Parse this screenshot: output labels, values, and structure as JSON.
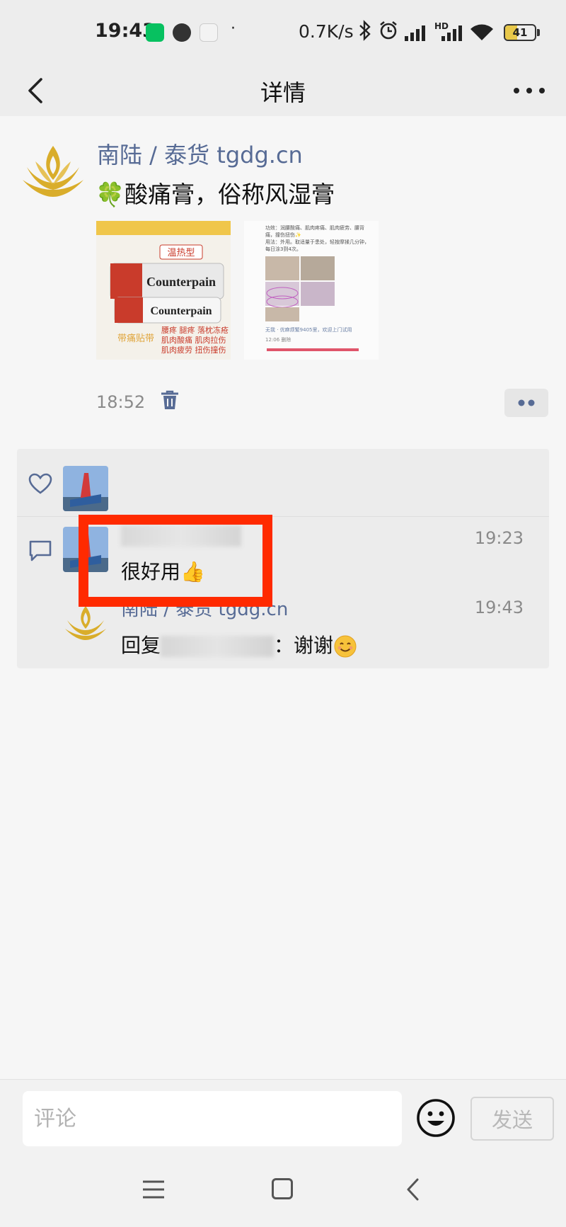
{
  "status_bar": {
    "time": "19:43",
    "dot": "·",
    "network_speed": "0.7K/s",
    "network_type": "HD",
    "battery_level": "41",
    "battery_fraction": 0.41,
    "icons": [
      "wechat-icon",
      "clock-app-icon",
      "weather-icon",
      "bluetooth-icon",
      "alarm-icon",
      "signal-icon",
      "wifi-icon",
      "battery-icon"
    ]
  },
  "nav": {
    "title": "详情",
    "back_icon": "chevron-left-icon",
    "more_icon": "more-dots-icon"
  },
  "post": {
    "author": "南陆 / 泰货 tgdg.cn",
    "text": "🍀酸痛膏，俗称风湿膏",
    "image1": {
      "badge": "温热型",
      "brand": "Counterpain",
      "lines": [
        "腰疼 腿疼 落枕冻疮",
        "肌肉酸痛 肌肉拉伤",
        "肌肉疲劳 扭伤撞伤"
      ],
      "stamp": "带痛贴带"
    },
    "image2": {
      "lines": [
        "功效：润腰酸痛、肌肉疼痛、肌肉疲劳、腰背",
        "痛，撞伤扭伤✨",
        "用法：外用。取适量于患处，轻按摩揉几分钟，",
        "每日涂3到4次。"
      ],
      "footer": "无我 · 优麻烦繁9405里，欢迎上门试用",
      "footer_time": "12:06 删除"
    },
    "time": "18:52"
  },
  "comments": [
    {
      "text": "很好用👍",
      "time": "19:23"
    },
    {
      "author": "南陆 / 泰货 tgdg.cn",
      "reply_prefix": "回复",
      "reply_text": "：谢谢",
      "time": "19:43"
    }
  ],
  "input": {
    "placeholder": "评论",
    "send_label": "发送"
  },
  "colors": {
    "link": "#576b95",
    "highlight": "#ff2a00",
    "wechat_green": "#07c160"
  }
}
